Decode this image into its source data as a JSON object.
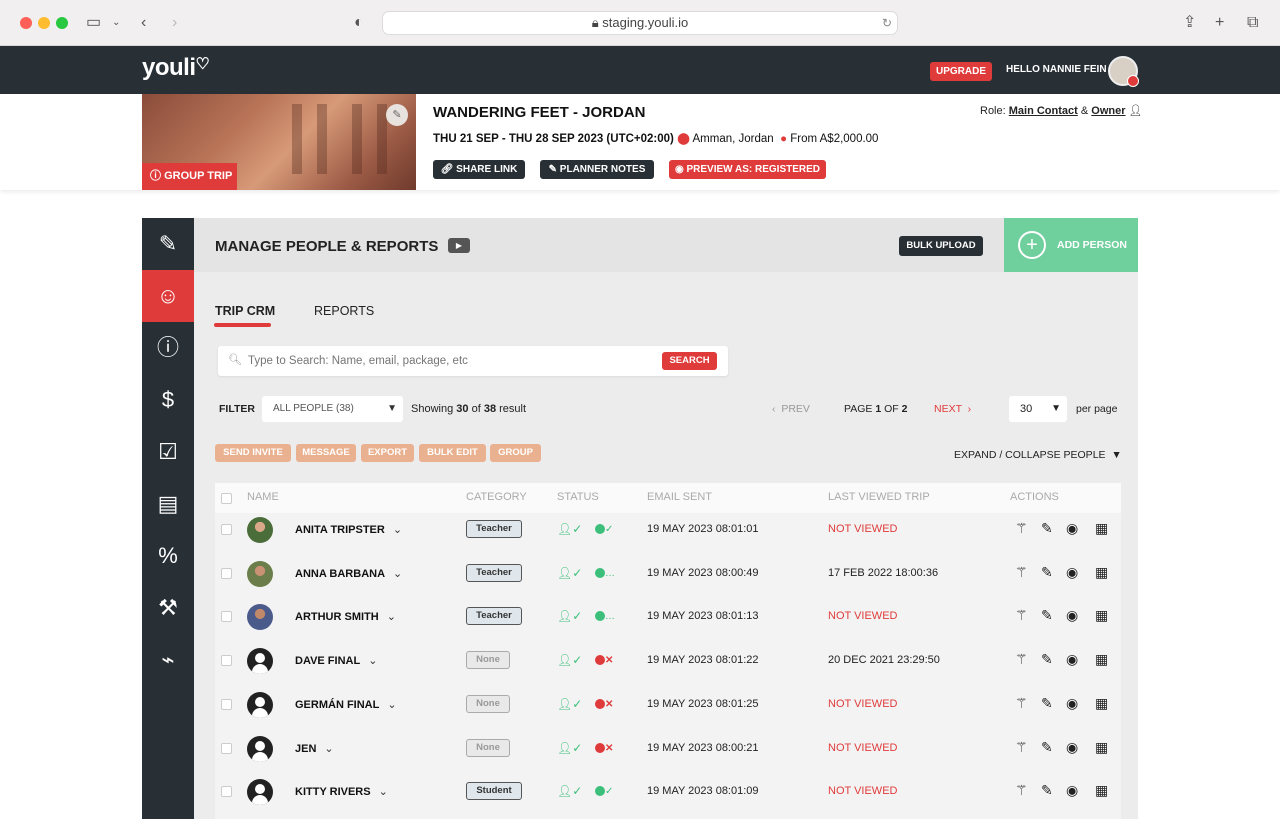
{
  "browser": {
    "url": "staging.youli.io"
  },
  "app": {
    "logo": "youli",
    "upgrade_label": "UPGRADE",
    "greeting": "HELLO NANNIE FEIN"
  },
  "trip": {
    "title": "WANDERING FEET - JORDAN",
    "dates": "THU 21 SEP - THU 28 SEP 2023 (UTC+02:00)",
    "location": "Amman, Jordan",
    "price": "From A$2,000.00",
    "badge": "GROUP TRIP",
    "role_prefix": "Role:",
    "role_main": "Main Contact",
    "role_amp": "&",
    "role_owner": "Owner",
    "buttons": {
      "share": "SHARE LINK",
      "notes": "PLANNER NOTES",
      "preview": "PREVIEW AS: REGISTERED"
    }
  },
  "header": {
    "title": "MANAGE PEOPLE & REPORTS",
    "bulk_upload": "BULK UPLOAD",
    "add_person": "ADD PERSON"
  },
  "tabs": [
    {
      "label": "TRIP CRM",
      "active": true
    },
    {
      "label": "REPORTS",
      "active": false
    }
  ],
  "search": {
    "placeholder": "Type to Search: Name, email, package, etc",
    "button": "SEARCH"
  },
  "filter": {
    "label": "FILTER",
    "selected": "ALL PEOPLE (38)",
    "showing_prefix": "Showing",
    "showing_count": "30",
    "showing_of": "of",
    "showing_total": "38",
    "showing_suffix": "result"
  },
  "pagination": {
    "prev": "PREV",
    "page": "PAGE",
    "page_num": "1",
    "of": "OF",
    "page_total": "2",
    "next": "NEXT",
    "per_page_value": "30",
    "per_page": "per page"
  },
  "actions_bar": {
    "send_invite": "SEND INVITE",
    "message": "MESSAGE",
    "export": "EXPORT",
    "bulk_edit": "BULK EDIT",
    "group": "GROUP",
    "expand": "EXPAND / COLLAPSE PEOPLE"
  },
  "table": {
    "columns": {
      "name": "NAME",
      "category": "CATEGORY",
      "status": "STATUS",
      "email_sent": "EMAIL SENT",
      "last_viewed": "LAST VIEWED TRIP",
      "actions": "ACTIONS"
    },
    "rows": [
      {
        "name": "ANITA TRIPSTER",
        "category": "Teacher",
        "email_sent": "19 MAY 2023 08:01:01",
        "last_viewed": "NOT VIEWED",
        "payment": "paid"
      },
      {
        "name": "ANNA BARBANA",
        "category": "Teacher",
        "email_sent": "19 MAY 2023 08:00:49",
        "last_viewed": "17 FEB 2022 18:00:36",
        "payment": "pending"
      },
      {
        "name": "ARTHUR SMITH",
        "category": "Teacher",
        "email_sent": "19 MAY 2023 08:01:13",
        "last_viewed": "NOT VIEWED",
        "payment": "pending"
      },
      {
        "name": "DAVE FINAL",
        "category": "None",
        "email_sent": "19 MAY 2023 08:01:22",
        "last_viewed": "20 DEC 2021 23:29:50",
        "payment": "unpaid"
      },
      {
        "name": "GERMÁN FINAL",
        "category": "None",
        "email_sent": "19 MAY 2023 08:01:25",
        "last_viewed": "NOT VIEWED",
        "payment": "unpaid"
      },
      {
        "name": "JEN",
        "category": "None",
        "email_sent": "19 MAY 2023 08:00:21",
        "last_viewed": "NOT VIEWED",
        "payment": "unpaid"
      },
      {
        "name": "KITTY RIVERS",
        "category": "Student",
        "email_sent": "19 MAY 2023 08:01:09",
        "last_viewed": "NOT VIEWED",
        "payment": "paid"
      }
    ]
  },
  "colors": {
    "accent_red": "#e03b3b",
    "dark": "#283036",
    "green": "#6fcf9d"
  }
}
